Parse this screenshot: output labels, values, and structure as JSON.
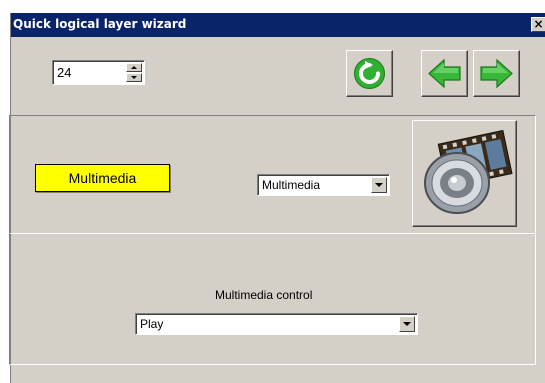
{
  "window": {
    "title": "Quick logical layer wizard",
    "close_glyph": "×"
  },
  "spinner": {
    "value": "24"
  },
  "toolbar": {
    "refresh_icon": "refresh-icon",
    "back_icon": "arrow-left-icon",
    "forward_icon": "arrow-right-icon",
    "accent_green": "#3cb43c"
  },
  "panel": {
    "type_label": "Multimedia",
    "type_select_value": "Multimedia",
    "media_icon": "speaker-film-icon",
    "control_label": "Multimedia control",
    "control_select_value": "Play"
  },
  "colors": {
    "titlebar": "#0a246a",
    "window_bg": "#d4d0c8",
    "highlight_label": "#ffff00"
  }
}
